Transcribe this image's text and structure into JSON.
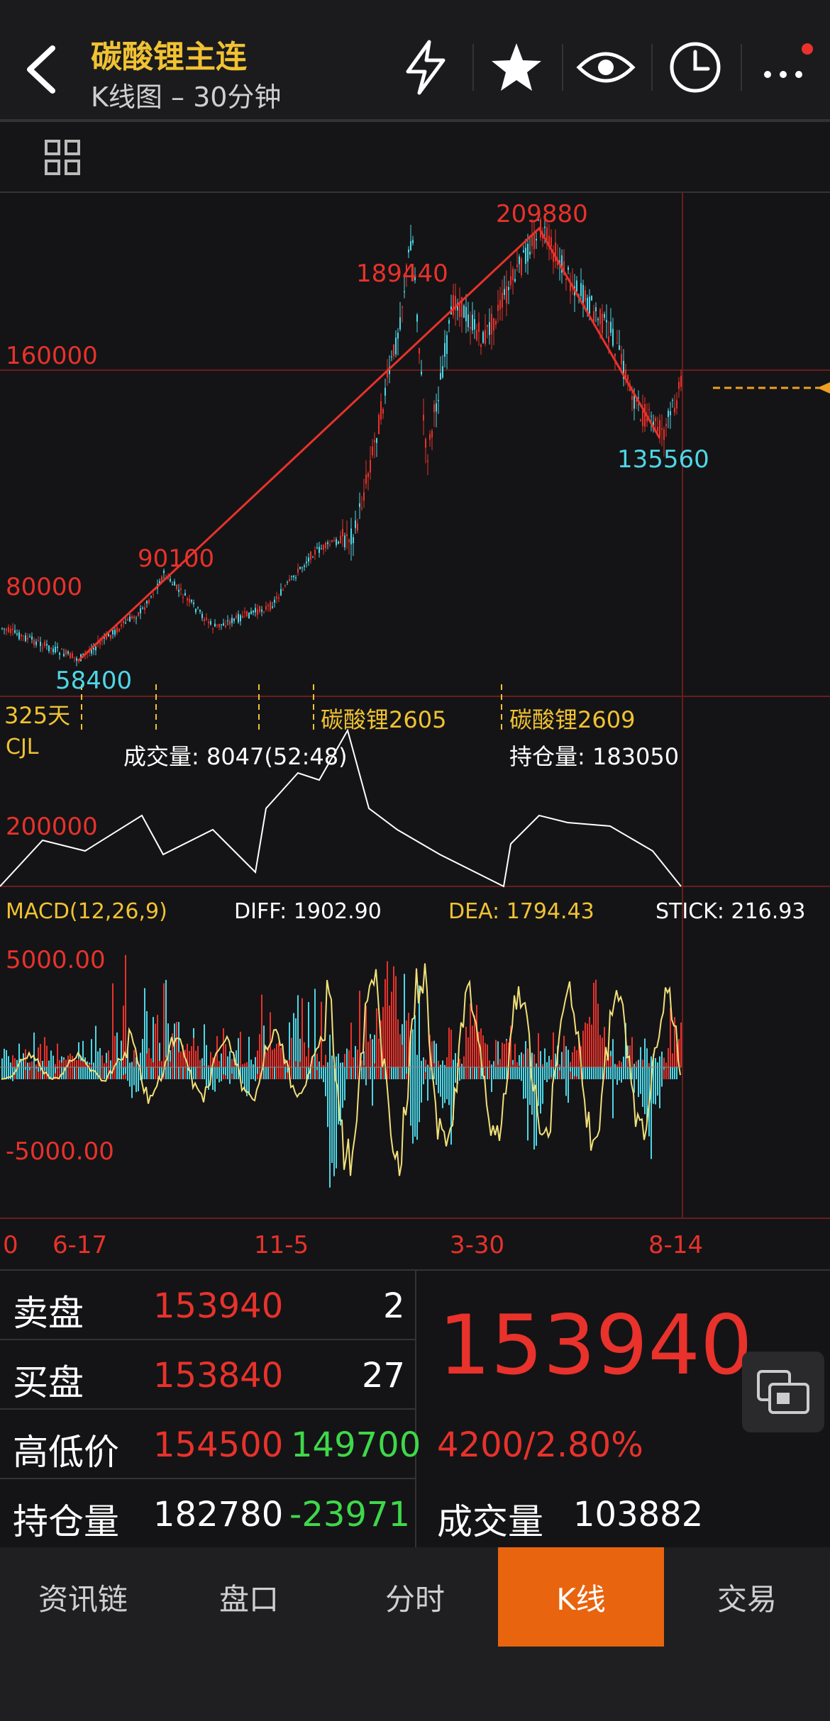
{
  "header": {
    "title": "碳酸锂主连",
    "subtitle": "K线图 – 30分钟"
  },
  "chart": {
    "price_labels": {
      "high": "160000",
      "low": "80000"
    },
    "annotations": {
      "peak": "209880",
      "left_high": "189440",
      "mid_high": "90100",
      "low": "58400",
      "recent_low": "135560"
    },
    "period_markers": {
      "days": "325天",
      "contract1": "碳酸锂2605",
      "contract2": "碳酸锂2609"
    },
    "volume_panel": {
      "name": "CJL",
      "volume_label": "成交量: 8047(52:48)",
      "oi_label": "持仓量: 183050",
      "scale_label": "200000"
    },
    "macd_panel": {
      "name": "MACD(12,26,9)",
      "diff": "DIFF: 1902.90",
      "dea": "DEA: 1794.43",
      "stick": "STICK: 216.93",
      "upper": "5000.00",
      "lower": "-5000.00"
    },
    "x_axis": {
      "d0": "0",
      "d1": "6-17",
      "d2": "11-5",
      "d3": "3-30",
      "d4": "8-14"
    },
    "colors": {
      "up": "#e8322b",
      "down": "#4fd6e6",
      "trend": "#e8322b",
      "dif": "#f1e07a",
      "marker": "#f1c232",
      "price_line": "#f0a020"
    }
  },
  "quote": {
    "sell": {
      "label": "卖盘",
      "price": "153940",
      "qty": "2"
    },
    "buy": {
      "label": "买盘",
      "price": "153840",
      "qty": "27"
    },
    "highlow": {
      "label": "高低价",
      "high": "154500",
      "low": "149700"
    },
    "oi": {
      "label": "持仓量",
      "value": "182780",
      "change": "-23971"
    },
    "last_price": "153940",
    "change": "4200/2.80%",
    "volume": {
      "label": "成交量",
      "value": "103882"
    }
  },
  "tabs": [
    "资讯链",
    "盘口",
    "分时",
    "K线",
    "交易"
  ]
}
